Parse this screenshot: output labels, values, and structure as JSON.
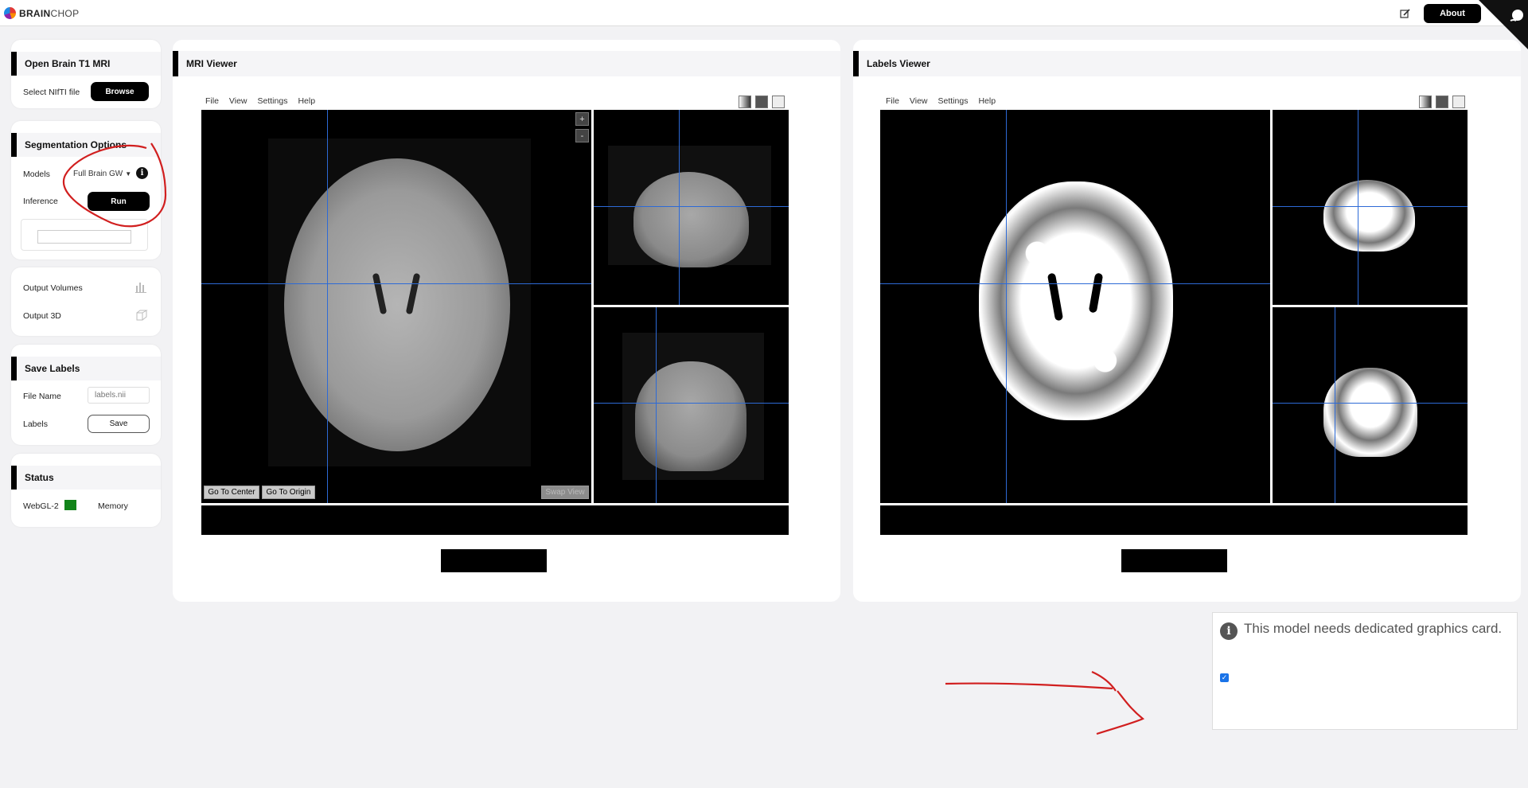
{
  "app": {
    "brand_bold": "BRAIN",
    "brand_rest": "CHOP",
    "about_label": "About"
  },
  "left": {
    "open_card": {
      "title": "Open Brain T1 MRI",
      "select_label": "Select NIfTI file",
      "browse_label": "Browse"
    },
    "seg_card": {
      "title": "Segmentation Options",
      "models_label": "Models",
      "model_value": "Full Brain GW",
      "inference_label": "Inference",
      "run_label": "Run"
    },
    "output_card": {
      "volumes_label": "Output Volumes",
      "output3d_label": "Output 3D"
    },
    "save_card": {
      "title": "Save Labels",
      "filename_label": "File Name",
      "filename_placeholder": "labels.nii",
      "labels_label": "Labels",
      "save_label": "Save"
    },
    "status_card": {
      "title": "Status",
      "webgl_label": "WebGL-2",
      "webgl_color": "#12841a",
      "memory_label": "Memory"
    }
  },
  "mri_viewer": {
    "title": "MRI Viewer",
    "menu": [
      "File",
      "View",
      "Settings",
      "Help"
    ],
    "zoom_in": "+",
    "zoom_out": "-",
    "go_center": "Go To Center",
    "go_origin": "Go To Origin",
    "swap_view": "Swap View"
  },
  "labels_viewer": {
    "title": "Labels Viewer",
    "menu": [
      "File",
      "View",
      "Settings",
      "Help"
    ]
  },
  "notification": {
    "message": "This model needs dedicated graphics card.",
    "checkbox_checked": true
  },
  "colors": {
    "crosshair": "#2d6ad6",
    "annotation": "#d11f1f"
  }
}
